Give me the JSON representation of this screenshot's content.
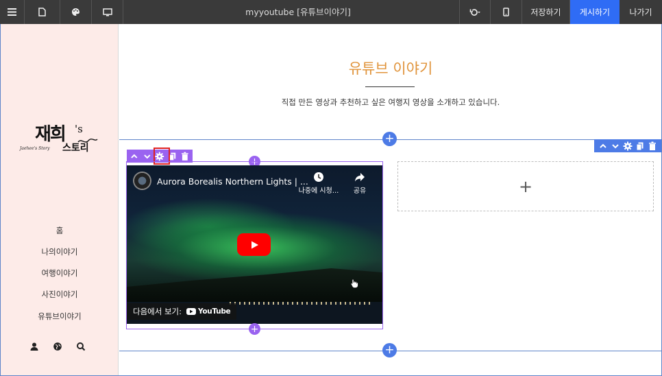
{
  "topbar": {
    "title": "myyoutube [유튜브이야기]",
    "save_label": "저장하기",
    "publish_label": "게시하기",
    "exit_label": "나가기"
  },
  "sidebar": {
    "logo": {
      "main": "재희",
      "suffix": "'s",
      "sub": "스토리",
      "script": "Jaehee's Story"
    },
    "nav": [
      {
        "label": "홈"
      },
      {
        "label": "나의이야기"
      },
      {
        "label": "여행이야기"
      },
      {
        "label": "사진이야기"
      },
      {
        "label": "유튜브이야기"
      }
    ]
  },
  "main": {
    "title": "유튜브 이야기",
    "description": "직접 만든 영상과 추천하고 싶은 여행지 영상을 소개하고 있습니다.",
    "empty_slot_label": "+"
  },
  "video": {
    "title": "Aurora Borealis Northern Lights | ...",
    "watch_later_label": "나중에 시청...",
    "share_label": "공유",
    "watch_on_label": "다음에서 보기:",
    "youtube_label": "YouTube"
  },
  "colors": {
    "topbar": "#3a3a3a",
    "publish": "#2f6cf5",
    "sidebar_bg": "#fdebe8",
    "title_accent": "#e0933a",
    "row_toolbar": "#4d7be6",
    "element_toolbar": "#9a63f0",
    "highlight": "#e02020"
  }
}
